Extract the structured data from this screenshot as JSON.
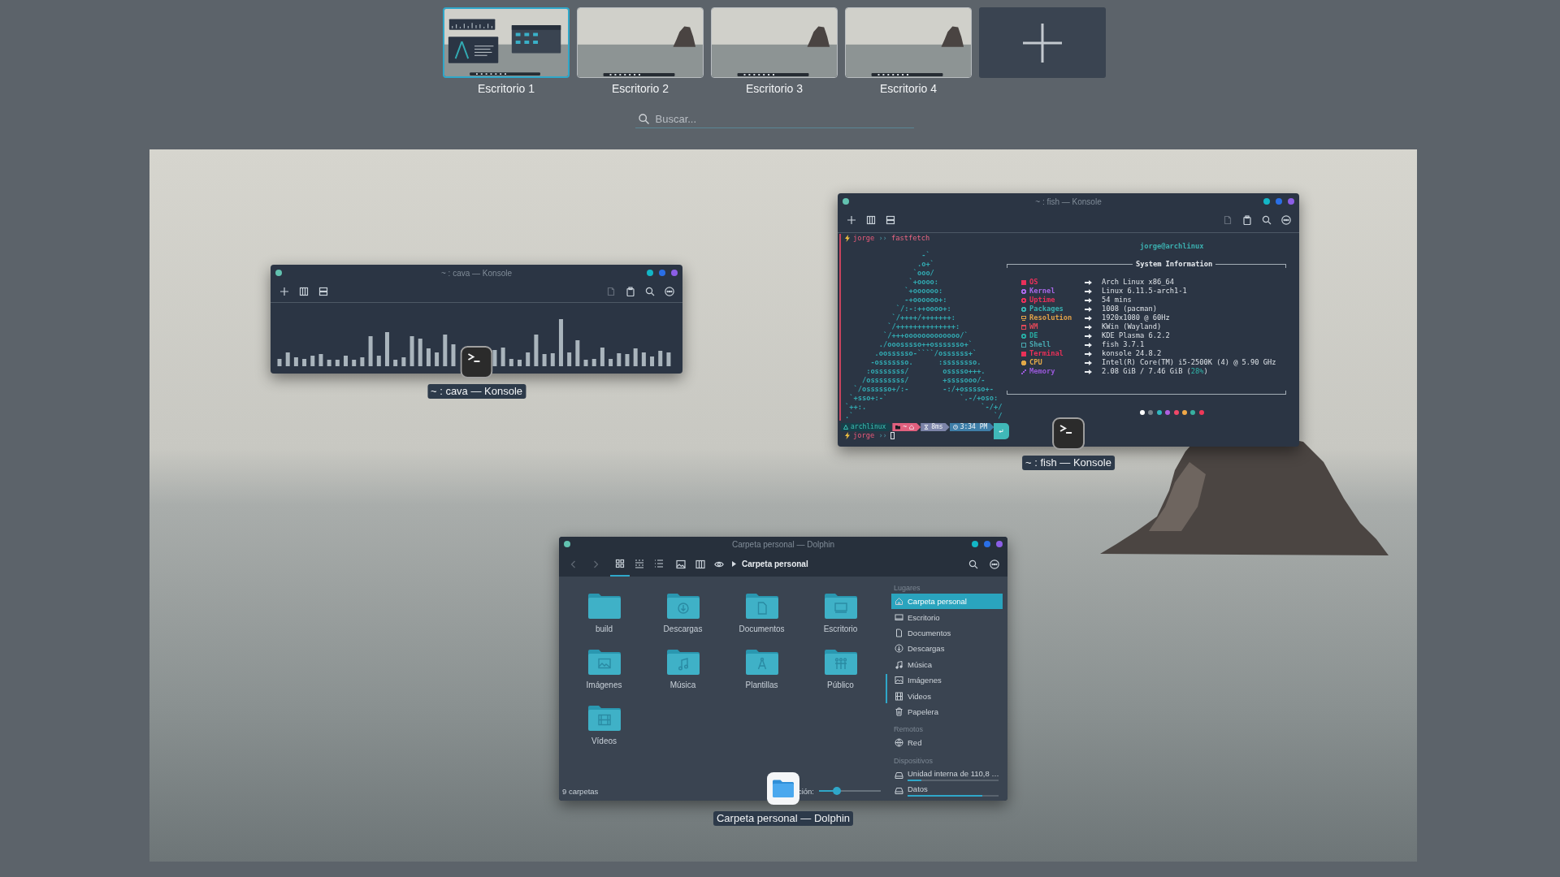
{
  "desktops": [
    {
      "label": "Escritorio 1",
      "selected": true,
      "kind": "windows"
    },
    {
      "label": "Escritorio 2",
      "selected": false,
      "kind": "empty"
    },
    {
      "label": "Escritorio 3",
      "selected": false,
      "kind": "empty"
    },
    {
      "label": "Escritorio 4",
      "selected": false,
      "kind": "empty"
    }
  ],
  "search": {
    "placeholder": "Buscar..."
  },
  "cava_window": {
    "title": "~ : cava — Konsole",
    "copy_button": {
      "disabled": true
    },
    "caption": "~ : cava — Konsole"
  },
  "fish_window": {
    "title": "~ : fish — Konsole",
    "copy_button": {
      "disabled": true
    },
    "command_prompt": {
      "user": "jorge",
      "separator": "››",
      "command": "fastfetch"
    },
    "logo_lines": [
      "                  -`",
      "                 .o+`",
      "                `ooo/",
      "               `+oooo:",
      "              `+oooooo:",
      "              -+oooooo+:",
      "            `/:-:++oooo+:",
      "           `/++++/+++++++:",
      "          `/++++++++++++++:",
      "         `/+++ooooooooooooo/`",
      "        ./ooosssso++osssssso+`",
      "       .oossssso-````/ossssss+`",
      "      -osssssso.      :ssssssso.",
      "     :osssssss/        osssso+++.",
      "    /ossssssss/        +ssssooo/-",
      "  `/ossssso+/:-        -:/+osssso+-",
      " `+sso+:-`                 `.-/+oso:",
      "`++:.                           `-/+/",
      ".`                                 `/"
    ],
    "header": "jorge@archlinux",
    "info_title": "System Information",
    "info_rows": [
      {
        "label": "OS",
        "value": "Arch Linux x86_64",
        "color": "#e8305a"
      },
      {
        "label": "Kernel",
        "value": "Linux 6.11.5-arch1-1",
        "color": "#a868e8"
      },
      {
        "label": "Uptime",
        "value": "54 mins",
        "color": "#e8305a"
      },
      {
        "label": "Packages",
        "value": "1008 (pacman)",
        "color": "#38b0b0"
      },
      {
        "label": "Resolution",
        "value": "1920x1080 @ 60Hz",
        "color": "#e0a048"
      },
      {
        "label": "WM",
        "value": "KWin (Wayland)",
        "color": "#e04858"
      },
      {
        "label": "DE",
        "value": "KDE Plasma 6.2.2",
        "color": "#28a8a0"
      },
      {
        "label": "Shell",
        "value": "fish 3.7.1",
        "color": "#48a8b0"
      },
      {
        "label": "Terminal",
        "value": "konsole 24.8.2",
        "color": "#e83058"
      },
      {
        "label": "CPU",
        "value": "Intel(R) Core(TM) i5-2500K (4) @ 5.90 GHz",
        "color": "#e0a848"
      },
      {
        "label": "Memory",
        "value": "2.08 GiB / 7.46 GiB (",
        "value_accent": "28%",
        "value_end": ")",
        "color": "#9858d8"
      }
    ],
    "palette": [
      {
        "color": "#ffffff"
      },
      {
        "color": "#7a828a"
      },
      {
        "color": "#30b8c0"
      },
      {
        "color": "#b060e0"
      },
      {
        "color": "#f04868"
      },
      {
        "color": "#f0a848"
      },
      {
        "color": "#38b0a0"
      },
      {
        "color": "#f03858"
      }
    ],
    "prompt_bar": [
      {
        "kind": "host",
        "text": "archlinux",
        "color": "#17404a"
      },
      {
        "kind": "path",
        "text": "~",
        "color": "#e0607e"
      },
      {
        "kind": "duration",
        "text": "8ms",
        "color": "#7c84a8"
      },
      {
        "kind": "time",
        "text": "3:34 PM",
        "color": "#3e7ea8"
      },
      {
        "kind": "status",
        "color": "#40b8b8"
      }
    ],
    "input_prompt": {
      "user": "jorge",
      "separator": "››",
      "cursor": true
    },
    "caption": "~ : fish — Konsole"
  },
  "dolphin_window": {
    "title": "Carpeta personal — Dolphin",
    "back_button": {
      "disabled": true
    },
    "forward_button": {
      "disabled": true
    },
    "view_buttons": [
      {
        "kind": "icons",
        "selected": true
      },
      {
        "kind": "compact",
        "selected": false
      },
      {
        "kind": "details",
        "selected": false
      }
    ],
    "breadcrumb": "Carpeta personal",
    "folders": [
      {
        "name": "build",
        "kind": "plain"
      },
      {
        "name": "Descargas",
        "kind": "download"
      },
      {
        "name": "Documentos",
        "kind": "document"
      },
      {
        "name": "Escritorio",
        "kind": "desktop"
      },
      {
        "name": "Imágenes",
        "kind": "image"
      },
      {
        "name": "Música",
        "kind": "music"
      },
      {
        "name": "Plantillas",
        "kind": "template"
      },
      {
        "name": "Público",
        "kind": "public"
      },
      {
        "name": "Vídeos",
        "kind": "video"
      }
    ],
    "status": "9 carpetas",
    "zoom_label": "ción:",
    "zoom_slider": {
      "level": 0.26
    },
    "places": [
      {
        "heading": "Lugares",
        "items": [
          {
            "label": "Carpeta personal",
            "kind": "home",
            "selected": true
          },
          {
            "label": "Escritorio",
            "kind": "desktop",
            "selected": false
          },
          {
            "label": "Documentos",
            "kind": "document",
            "selected": false
          },
          {
            "label": "Descargas",
            "kind": "download",
            "selected": false
          },
          {
            "label": "Música",
            "kind": "music",
            "selected": false
          },
          {
            "label": "Imágenes",
            "kind": "image",
            "selected": false
          },
          {
            "label": "Videos",
            "kind": "video",
            "selected": false
          },
          {
            "label": "Papelera",
            "kind": "trash",
            "selected": false
          }
        ]
      },
      {
        "heading": "Remotos",
        "items": [
          {
            "label": "Red",
            "kind": "network",
            "selected": false
          }
        ]
      },
      {
        "heading": "Dispositivos",
        "items": [
          {
            "label": "Unidad interna de 110,8 …",
            "kind": "drive",
            "selected": false,
            "level": 0.15
          },
          {
            "label": "Datos",
            "kind": "drive",
            "selected": false,
            "level": 0.82
          }
        ]
      }
    ],
    "caption": "Carpeta personal — Dolphin"
  }
}
